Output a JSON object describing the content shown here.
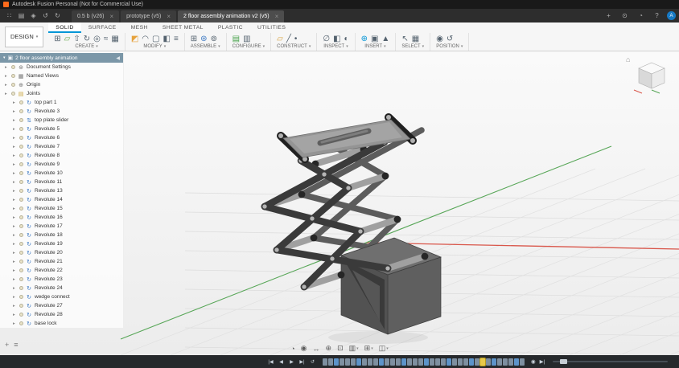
{
  "title_bar": {
    "title": "Autodesk Fusion Personal (Not for Commercial Use)"
  },
  "doc_bar": {
    "close_glyph": "×",
    "left_icons": [
      {
        "name": "app-grid-icon",
        "glyph": "∷"
      },
      {
        "name": "data-panel-icon",
        "glyph": "▤"
      },
      {
        "name": "save-icon",
        "glyph": "◈"
      },
      {
        "name": "undo-icon",
        "glyph": "↺"
      },
      {
        "name": "redo-icon",
        "glyph": "↻"
      }
    ],
    "tabs": [
      {
        "label": "0.5 b (v26)",
        "active": false
      },
      {
        "label": "prototype (v5)",
        "active": false
      },
      {
        "label": "2 floor assembly animation v2 (v5)",
        "active": true
      }
    ],
    "right_icons": [
      {
        "name": "new-tab-icon",
        "glyph": "+"
      },
      {
        "name": "job-status-icon",
        "glyph": "⊙"
      },
      {
        "name": "notifications-icon",
        "glyph": "◔"
      },
      {
        "name": "help-icon",
        "glyph": "?"
      }
    ],
    "avatar_initial": "A"
  },
  "ribbon": {
    "design_label": "DESIGN",
    "caret": "▾",
    "tabs": [
      {
        "label": "SOLID",
        "active": true
      },
      {
        "label": "SURFACE",
        "active": false
      },
      {
        "label": "MESH",
        "active": false
      },
      {
        "label": "SHEET METAL",
        "active": false
      },
      {
        "label": "PLASTIC",
        "active": false
      },
      {
        "label": "UTILITIES",
        "active": false
      }
    ],
    "groups": [
      {
        "label": "CREATE",
        "icons": [
          {
            "name": "new-component-icon",
            "glyph": "⊞",
            "color": "#54626e"
          },
          {
            "name": "create-sketch-icon",
            "glyph": "▱",
            "color": "#6aa84f"
          },
          {
            "name": "extrude-icon",
            "glyph": "⇧",
            "color": "#54626e"
          },
          {
            "name": "revolve-icon",
            "glyph": "↻",
            "color": "#54626e"
          },
          {
            "name": "hole-icon",
            "glyph": "◎",
            "color": "#54626e"
          },
          {
            "name": "thread-icon",
            "glyph": "≈",
            "color": "#54626e"
          },
          {
            "name": "pattern-icon",
            "glyph": "▦",
            "color": "#54626e"
          }
        ]
      },
      {
        "label": "MODIFY",
        "icons": [
          {
            "name": "press-pull-icon",
            "glyph": "◩",
            "color": "#e6a23c"
          },
          {
            "name": "fillet-icon",
            "glyph": "◠",
            "color": "#54626e"
          },
          {
            "name": "shell-icon",
            "glyph": "▢",
            "color": "#54626e"
          },
          {
            "name": "combine-icon",
            "glyph": "◧",
            "color": "#54626e"
          },
          {
            "name": "change-parameters-icon",
            "glyph": "≡",
            "color": "#54626e"
          }
        ]
      },
      {
        "label": "ASSEMBLE",
        "icons": [
          {
            "name": "new-component-icon",
            "glyph": "⊞",
            "color": "#54626e"
          },
          {
            "name": "joint-icon",
            "glyph": "⊛",
            "color": "#3b78c3"
          },
          {
            "name": "motion-link-icon",
            "glyph": "⊚",
            "color": "#54626e"
          }
        ]
      },
      {
        "label": "CONFIGURE",
        "icons": [
          {
            "name": "configure-icon",
            "glyph": "▤",
            "color": "#43a047"
          },
          {
            "name": "configuration-table-icon",
            "glyph": "▥",
            "color": "#54626e"
          }
        ]
      },
      {
        "label": "CONSTRUCT",
        "icons": [
          {
            "name": "construction-plane-icon",
            "glyph": "▱",
            "color": "#d9a441"
          },
          {
            "name": "construction-axis-icon",
            "glyph": "╱",
            "color": "#54626e"
          },
          {
            "name": "construction-point-icon",
            "glyph": "•",
            "color": "#54626e"
          }
        ]
      },
      {
        "label": "INSPECT",
        "icons": [
          {
            "name": "measure-icon",
            "glyph": "∅",
            "color": "#54626e"
          },
          {
            "name": "interference-icon",
            "glyph": "◧",
            "color": "#54626e"
          },
          {
            "name": "section-analysis-icon",
            "glyph": "◐",
            "color": "#54626e"
          }
        ]
      },
      {
        "label": "INSERT",
        "icons": [
          {
            "name": "insert-derive-icon",
            "glyph": "⊕",
            "color": "#0696d7"
          },
          {
            "name": "decal-icon",
            "glyph": "▣",
            "color": "#54626e"
          },
          {
            "name": "insert-mesh-icon",
            "glyph": "▲",
            "color": "#54626e"
          }
        ]
      },
      {
        "label": "SELECT",
        "icons": [
          {
            "name": "select-icon",
            "glyph": "↖",
            "color": "#54626e"
          },
          {
            "name": "selection-filter-icon",
            "glyph": "▦",
            "color": "#54626e"
          }
        ]
      },
      {
        "label": "POSITION",
        "icons": [
          {
            "name": "capture-position-icon",
            "glyph": "◉",
            "color": "#54626e"
          },
          {
            "name": "revert-position-icon",
            "glyph": "↺",
            "color": "#54626e"
          }
        ]
      }
    ]
  },
  "browser": {
    "root": {
      "label": "2 floor assembly animation"
    },
    "tree_caret": "▸",
    "collapse_glyph": "◀",
    "items": [
      {
        "label": "Document Settings",
        "icon": "settings",
        "indent": 0
      },
      {
        "label": "Named Views",
        "icon": "views",
        "indent": 0
      },
      {
        "label": "Origin",
        "icon": "origin",
        "indent": 0
      },
      {
        "label": "Joints",
        "icon": "folder",
        "indent": 0
      },
      {
        "label": "top part 1",
        "icon": "joint",
        "indent": 1
      },
      {
        "label": "Revolute 3",
        "icon": "joint",
        "indent": 1
      },
      {
        "label": "top plate slider",
        "icon": "slider-joint",
        "indent": 1
      },
      {
        "label": "Revolute 5",
        "icon": "joint",
        "indent": 1
      },
      {
        "label": "Revolute 6",
        "icon": "joint",
        "indent": 1
      },
      {
        "label": "Revolute 7",
        "icon": "joint",
        "indent": 1
      },
      {
        "label": "Revolute 8",
        "icon": "joint",
        "indent": 1
      },
      {
        "label": "Revolute 9",
        "icon": "joint",
        "indent": 1
      },
      {
        "label": "Revolute 10",
        "icon": "joint",
        "indent": 1
      },
      {
        "label": "Revolute 11",
        "icon": "joint",
        "indent": 1
      },
      {
        "label": "Revolute 13",
        "icon": "joint",
        "indent": 1
      },
      {
        "label": "Revolute 14",
        "icon": "joint",
        "indent": 1
      },
      {
        "label": "Revolute 15",
        "icon": "joint",
        "indent": 1
      },
      {
        "label": "Revolute 16",
        "icon": "joint",
        "indent": 1
      },
      {
        "label": "Revolute 17",
        "icon": "joint",
        "indent": 1
      },
      {
        "label": "Revolute 18",
        "icon": "joint",
        "indent": 1
      },
      {
        "label": "Revolute 19",
        "icon": "joint",
        "indent": 1
      },
      {
        "label": "Revolute 20",
        "icon": "joint",
        "indent": 1
      },
      {
        "label": "Revolute 21",
        "icon": "joint",
        "indent": 1
      },
      {
        "label": "Revolute 22",
        "icon": "joint",
        "indent": 1
      },
      {
        "label": "Revolute 23",
        "icon": "joint",
        "indent": 1
      },
      {
        "label": "Revolute 24",
        "icon": "joint",
        "indent": 1
      },
      {
        "label": "wedge connect",
        "icon": "joint",
        "indent": 1
      },
      {
        "label": "Revolute 27",
        "icon": "joint",
        "indent": 1
      },
      {
        "label": "Revolute 28",
        "icon": "joint",
        "indent": 1
      },
      {
        "label": "base lock",
        "icon": "joint",
        "indent": 1
      }
    ]
  },
  "viewport": {
    "bottom_left_icons": [
      {
        "name": "add-icon",
        "glyph": "+"
      },
      {
        "name": "comments-icon",
        "glyph": "≡"
      }
    ],
    "nav_icons": [
      {
        "name": "orbit-icon",
        "glyph": "◔",
        "caret": false
      },
      {
        "name": "look-at-icon",
        "glyph": "◉",
        "caret": false
      },
      {
        "name": "pan-icon",
        "glyph": "↔",
        "caret": false
      },
      {
        "name": "zoom-icon",
        "glyph": "⊕",
        "caret": false
      },
      {
        "name": "fit-icon",
        "glyph": "⊡",
        "caret": false
      },
      {
        "name": "display-settings-icon",
        "glyph": "▥",
        "caret": true
      },
      {
        "name": "grid-settings-icon",
        "glyph": "⊞",
        "caret": true
      },
      {
        "name": "viewports-icon",
        "glyph": "◫",
        "caret": true
      }
    ],
    "colors": {
      "x_axis": "#d9564a",
      "y_axis": "#57a657",
      "grid": "#dcdcdc"
    }
  },
  "timeline": {
    "playback": [
      {
        "name": "go-to-start-icon",
        "glyph": "|◀"
      },
      {
        "name": "step-back-icon",
        "glyph": "◀"
      },
      {
        "name": "play-icon",
        "glyph": "▶"
      },
      {
        "name": "go-to-end-icon",
        "glyph": "▶|"
      },
      {
        "name": "loop-icon",
        "glyph": "↺"
      }
    ],
    "features": {
      "count": 36,
      "highlight_index": 28,
      "alt_every": 4
    },
    "right_icons": [
      {
        "name": "timeline-marker-icon",
        "glyph": "◉"
      },
      {
        "name": "timeline-end-icon",
        "glyph": "▶|"
      }
    ],
    "highlight_color": "#e8c94a"
  }
}
